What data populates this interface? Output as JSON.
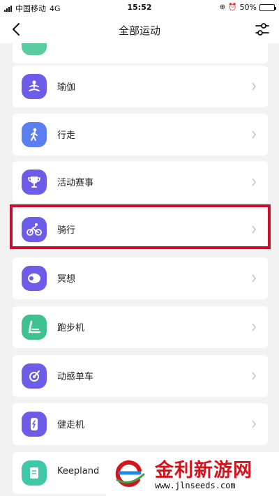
{
  "status_bar": {
    "carrier": "中国移动",
    "network": "4G",
    "time": "15:52",
    "battery": "50%",
    "battery_level": 0.5
  },
  "header": {
    "title": "全部运动",
    "back_icon": "chevron-left-icon",
    "filter_icon": "sliders-icon"
  },
  "sports": [
    {
      "label": "",
      "icon": "partial-icon",
      "color": "#5bcba0"
    },
    {
      "label": "瑜伽",
      "icon": "yoga-icon",
      "color": "#6c5ce7"
    },
    {
      "label": "行走",
      "icon": "walking-icon",
      "color": "#5b7ff0"
    },
    {
      "label": "活动赛事",
      "icon": "trophy-icon",
      "color": "#6c5ce7"
    },
    {
      "label": "骑行",
      "icon": "cycling-icon",
      "color": "#6c5ce7"
    },
    {
      "label": "冥想",
      "icon": "meditation-icon",
      "color": "#6c5ce7"
    },
    {
      "label": "跑步机",
      "icon": "treadmill-icon",
      "color": "#3ec28f"
    },
    {
      "label": "动感单车",
      "icon": "spinning-bike-icon",
      "color": "#6c5ce7"
    },
    {
      "label": "健走机",
      "icon": "walking-machine-icon",
      "color": "#6c5ce7"
    },
    {
      "label": "Keepland",
      "icon": "keepland-icon",
      "color": "#3ec8a8"
    }
  ],
  "highlight_color": "#c8102e",
  "watermark": {
    "title": "金利新游网",
    "url": "www.jlnseeds.com"
  }
}
